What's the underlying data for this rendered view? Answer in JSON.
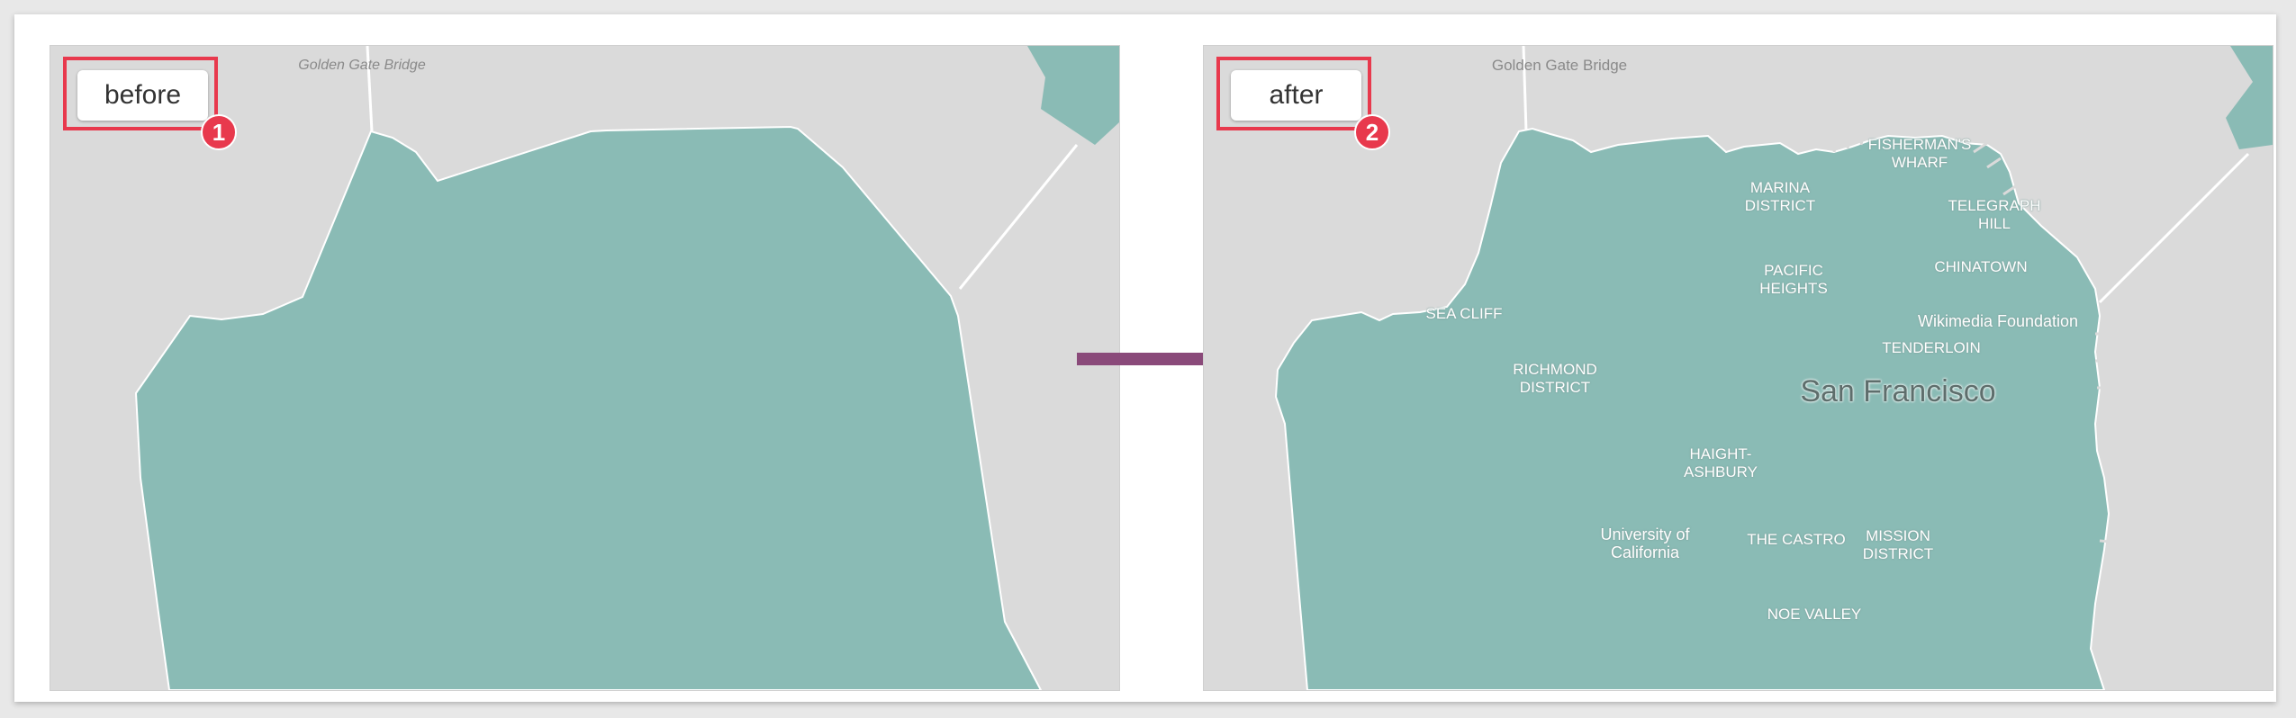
{
  "panels": {
    "before": {
      "tag_label": "before",
      "badge_number": "1",
      "map_labels": {
        "landmark": "Golden Gate Bridge"
      }
    },
    "after": {
      "tag_label": "after",
      "badge_number": "2",
      "map_labels": {
        "landmark": "Golden Gate Bridge",
        "city": "San Francisco",
        "fishermans_wharf": "FISHERMAN'S\nWHARF",
        "marina": "MARINA\nDISTRICT",
        "telegraph_hill": "TELEGRAPH\nHILL",
        "pacific_heights": "PACIFIC\nHEIGHTS",
        "chinatown": "CHINATOWN",
        "sea_cliff": "SEA CLIFF",
        "wikimedia": "Wikimedia Foundation",
        "tenderloin": "TENDERLOIN",
        "richmond": "RICHMOND\nDISTRICT",
        "haight": "HAIGHT-\nASHBURY",
        "ucsf": "University of\nCalifornia",
        "castro": "THE CASTRO",
        "mission": "MISSION\nDISTRICT",
        "noe_valley": "NOE VALLEY"
      }
    }
  },
  "colors": {
    "land": "#dadada",
    "region_fill": "#8abbb5",
    "callout": "#e8394d",
    "arrow": "#8a4a7a"
  }
}
